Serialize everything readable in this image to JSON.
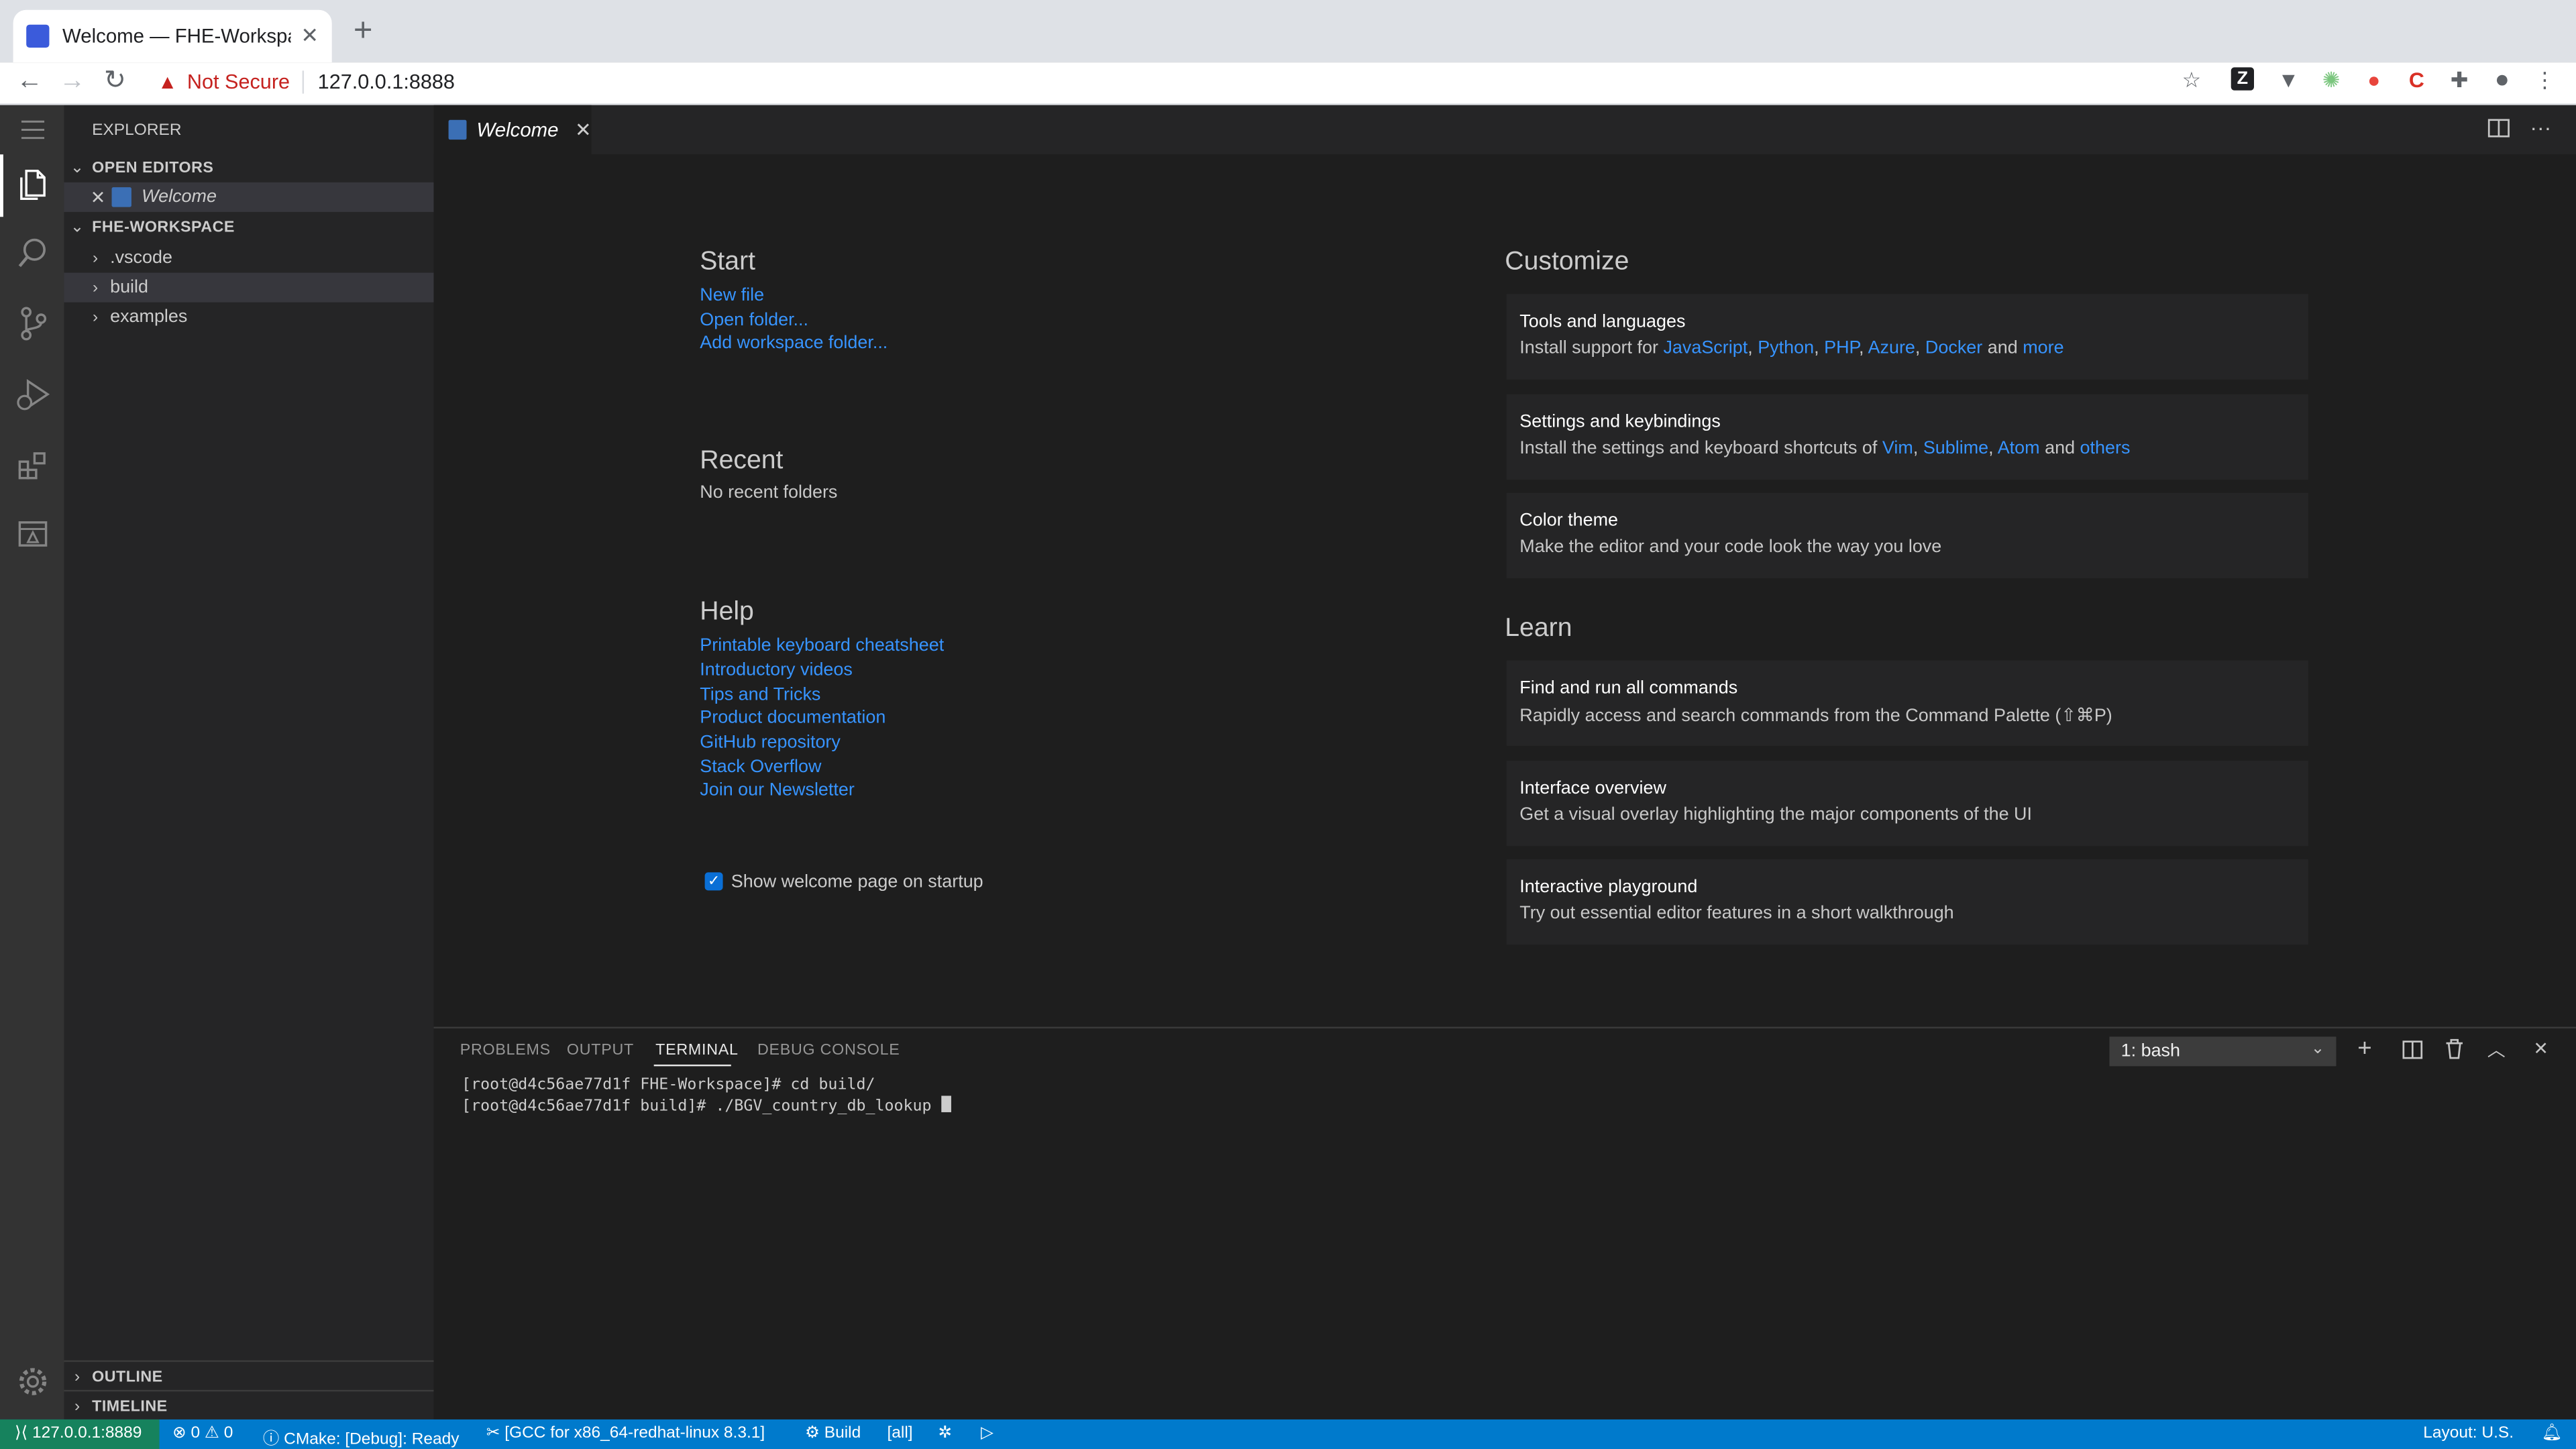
{
  "browser": {
    "tab_title": "Welcome — FHE-Workspace — ",
    "security_label": "Not Secure",
    "url": "127.0.0.1:8888"
  },
  "explorer": {
    "title": "EXPLORER",
    "open_editors_header": "OPEN EDITORS",
    "open_editor_item": "Welcome",
    "workspace_header": "FHE-WORKSPACE",
    "folders": [
      ".vscode",
      "build",
      "examples"
    ],
    "outline_header": "OUTLINE",
    "timeline_header": "TIMELINE"
  },
  "editor": {
    "tab_label": "Welcome"
  },
  "welcome": {
    "start": {
      "title": "Start",
      "links": [
        "New file",
        "Open folder...",
        "Add workspace folder..."
      ]
    },
    "recent": {
      "title": "Recent",
      "empty_text": "No recent folders"
    },
    "help": {
      "title": "Help",
      "links": [
        "Printable keyboard cheatsheet",
        "Introductory videos",
        "Tips and Tricks",
        "Product documentation",
        "GitHub repository",
        "Stack Overflow",
        "Join our Newsletter"
      ]
    },
    "show_on_startup": {
      "label": "Show welcome page on startup",
      "checked": true
    },
    "customize": {
      "title": "Customize",
      "cards": [
        {
          "title": "Tools and languages",
          "prefix": "Install support for ",
          "links": [
            "JavaScript",
            "Python",
            "PHP",
            "Azure",
            "Docker"
          ],
          "and": "and",
          "last": "more"
        },
        {
          "title": "Settings and keybindings",
          "prefix": "Install the settings and keyboard shortcuts of ",
          "links": [
            "Vim",
            "Sublime",
            "Atom"
          ],
          "and": "and",
          "last": "others"
        },
        {
          "title": "Color theme",
          "desc": "Make the editor and your code look the way you love"
        }
      ]
    },
    "learn": {
      "title": "Learn",
      "cards": [
        {
          "title": "Find and run all commands",
          "desc": "Rapidly access and search commands from the Command Palette (⇧⌘P)"
        },
        {
          "title": "Interface overview",
          "desc": "Get a visual overlay highlighting the major components of the UI"
        },
        {
          "title": "Interactive playground",
          "desc": "Try out essential editor features in a short walkthrough"
        }
      ]
    }
  },
  "panel": {
    "tabs": [
      "PROBLEMS",
      "OUTPUT",
      "TERMINAL",
      "DEBUG CONSOLE"
    ],
    "active_tab": "TERMINAL",
    "terminal_select": "1: bash",
    "terminal_lines": [
      "[root@d4c56ae77d1f FHE-Workspace]# cd build/",
      "[root@d4c56ae77d1f build]# ./BGV_country_db_lookup "
    ]
  },
  "statusbar": {
    "remote": "127.0.0.1:8889",
    "errors": "0",
    "warnings": "0",
    "cmake": "CMake: [Debug]: Ready",
    "kit": "[GCC for x86_64-redhat-linux 8.3.1]",
    "build": "Build",
    "target": "[all]",
    "layout": "Layout: U.S."
  },
  "colors": {
    "accent": "#007acc",
    "link": "#3794ff",
    "remote": "#16825d",
    "not_secure": "#c5221f"
  }
}
